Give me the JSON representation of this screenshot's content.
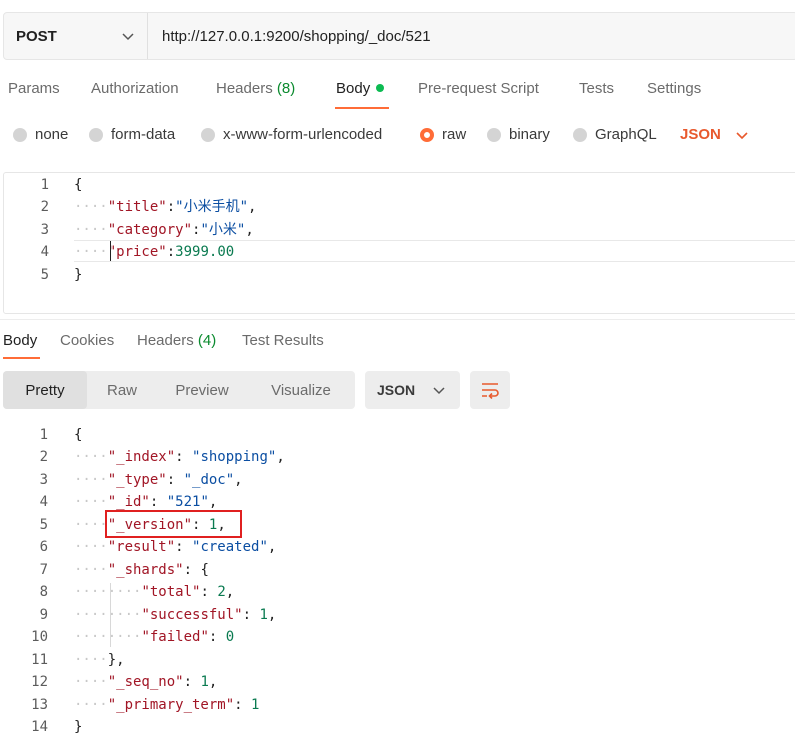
{
  "request": {
    "method": "POST",
    "url": "http://127.0.0.1:9200/shopping/_doc/521"
  },
  "request_tabs": [
    {
      "label": "Params"
    },
    {
      "label": "Authorization"
    },
    {
      "label": "Headers",
      "count": "(8)"
    },
    {
      "label": "Body"
    },
    {
      "label": "Pre-request Script"
    },
    {
      "label": "Tests"
    },
    {
      "label": "Settings"
    }
  ],
  "body_types": [
    {
      "label": "none"
    },
    {
      "label": "form-data"
    },
    {
      "label": "x-www-form-urlencoded"
    },
    {
      "label": "raw"
    },
    {
      "label": "binary"
    },
    {
      "label": "GraphQL"
    }
  ],
  "body_format": "JSON",
  "request_body": {
    "line_numbers": [
      "1",
      "2",
      "3",
      "4",
      "5"
    ],
    "open": "{",
    "close": "}",
    "fields": [
      {
        "key": "\"title\"",
        "value": "\"小米手机\""
      },
      {
        "key": "\"category\"",
        "value": "\"小米\""
      },
      {
        "key": "\"price\"",
        "value": "3999.00"
      }
    ]
  },
  "response_tabs": [
    {
      "label": "Body"
    },
    {
      "label": "Cookies"
    },
    {
      "label": "Headers",
      "count": "(4)"
    },
    {
      "label": "Test Results"
    }
  ],
  "view_modes": [
    "Pretty",
    "Raw",
    "Preview",
    "Visualize"
  ],
  "response_format": "JSON",
  "response_body": {
    "line_numbers": [
      "1",
      "2",
      "3",
      "4",
      "5",
      "6",
      "7",
      "8",
      "9",
      "10",
      "11",
      "12",
      "13",
      "14"
    ],
    "open": "{",
    "close": "}",
    "index": {
      "key": "\"_index\"",
      "value": "\"shopping\""
    },
    "type": {
      "key": "\"_type\"",
      "value": "\"_doc\""
    },
    "id": {
      "key": "\"_id\"",
      "value": "\"521\""
    },
    "version": {
      "key": "\"_version\"",
      "value": "1"
    },
    "result": {
      "key": "\"result\"",
      "value": "\"created\""
    },
    "shards": {
      "key": "\"_shards\"",
      "open": "{",
      "close": "},"
    },
    "total": {
      "key": "\"total\"",
      "value": "2"
    },
    "successful": {
      "key": "\"successful\"",
      "value": "1"
    },
    "failed": {
      "key": "\"failed\"",
      "value": "0"
    },
    "seq_no": {
      "key": "\"_seq_no\"",
      "value": "1"
    },
    "primary_term": {
      "key": "\"_primary_term\"",
      "value": "1"
    }
  },
  "colors": {
    "accent": "#ff6c37",
    "key": "#a11525",
    "string": "#0b4ea2",
    "number": "#0a7a50",
    "highlight": "#e02020"
  }
}
